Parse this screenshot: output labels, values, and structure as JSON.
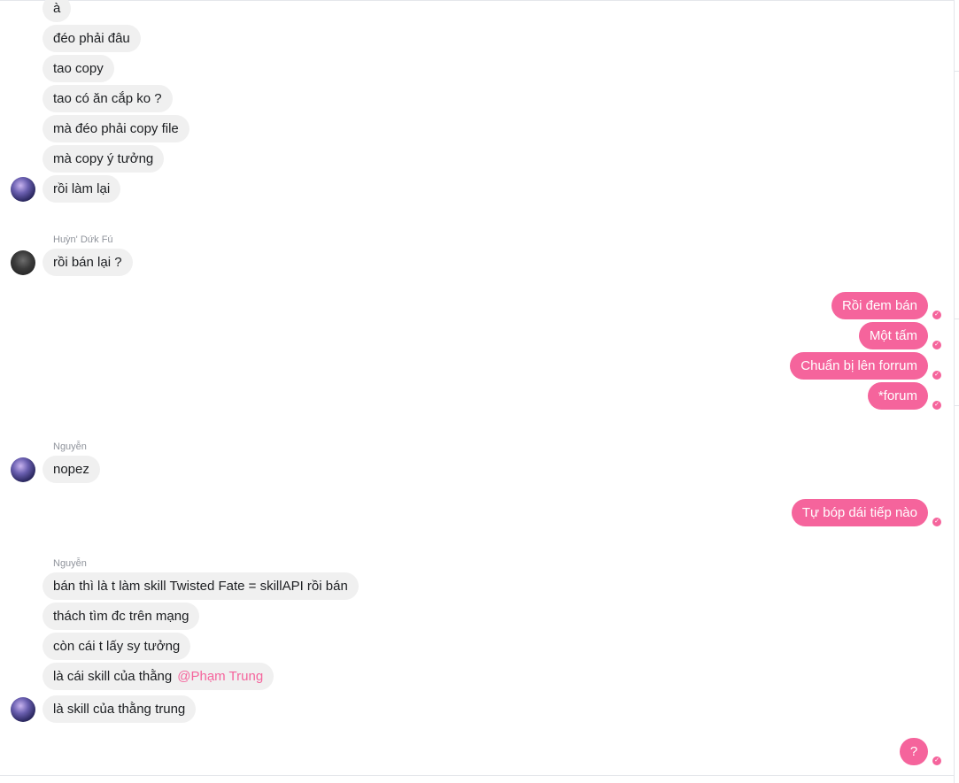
{
  "colors": {
    "accent": "#f5649c",
    "incoming_bubble": "#f0f0f0",
    "meta_text": "#90949c"
  },
  "icons": {
    "seen": "check-circle-icon"
  },
  "messages": {
    "m1": "à",
    "m2": "đéo phải đâu",
    "m3": "tao copy",
    "m4": "tao có ăn cắp ko ?",
    "m5": "mà đéo phải copy file",
    "m6": "mà copy ý tưởng",
    "m7": "rồi làm lại",
    "sender2": "Huỳn' Dứk Fú",
    "m8": "rồi bán lại ?",
    "o1": "Rồi đem bán",
    "o2": "Một tấm",
    "o3": "Chuẩn bị lên forrum",
    "o4": "*forum",
    "sender3": "Nguyễn",
    "m9": "nopez",
    "o5": "Tự bóp dái tiếp nào",
    "sender4": "Nguyễn",
    "m10": "bán  thì là t làm skill Twisted Fate = skillAPI rồi bán",
    "m11": "thách tìm đc trên mạng",
    "m12": "còn cái t lấy sy tưởng",
    "m13": "là cái skill của thằng",
    "m13_mention": "@Phạm Trung",
    "m14": "là skill của thằng trung",
    "o6": "?"
  }
}
